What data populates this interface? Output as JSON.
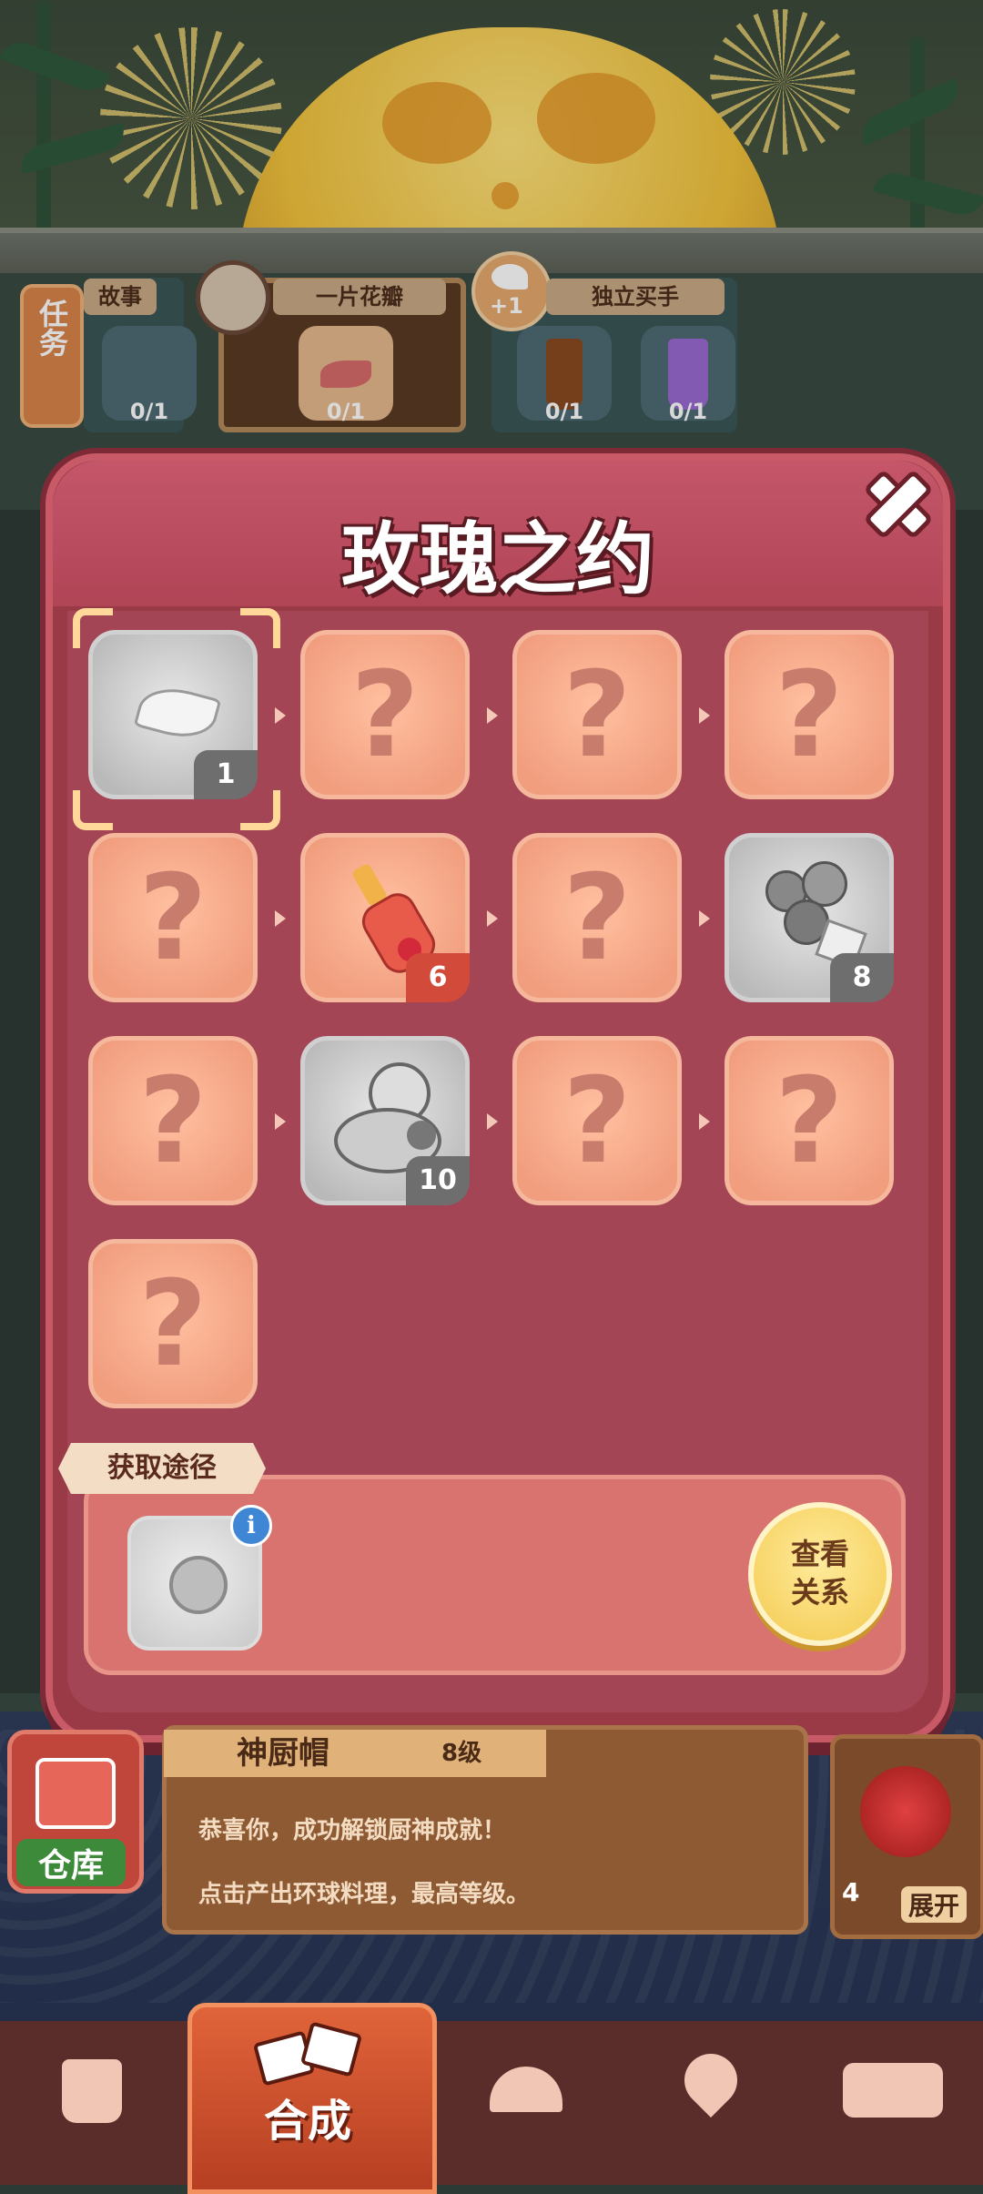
{
  "task_bar": {
    "tab_label": "任务",
    "cards": [
      {
        "header": "故事",
        "count": "0/1",
        "item": "green-jar-icon"
      },
      {
        "header": "一片花瓣",
        "count": "0/1",
        "item": "petal-icon"
      },
      {
        "header": "独立买手",
        "count": "0/1",
        "item": "coffee-cup-icon"
      },
      {
        "header": "",
        "count": "0/1",
        "item": "purple-drink-icon"
      }
    ],
    "reward_badge": "+1"
  },
  "modal": {
    "title": "玫瑰之约",
    "close_icon": "close-icon",
    "tiles": [
      {
        "kind": "silver",
        "icon": "petal-icon",
        "level": "1",
        "selected": true
      },
      {
        "kind": "unknown",
        "label": "?"
      },
      {
        "kind": "unknown",
        "label": "?"
      },
      {
        "kind": "unknown",
        "label": "?"
      },
      {
        "kind": "unknown",
        "label": "?"
      },
      {
        "kind": "item",
        "icon": "perfume-bottle-icon",
        "level": "6"
      },
      {
        "kind": "unknown",
        "label": "?"
      },
      {
        "kind": "silver",
        "icon": "rose-bouquet-icon",
        "level": "8"
      },
      {
        "kind": "unknown",
        "label": "?"
      },
      {
        "kind": "silver",
        "icon": "compact-mirror-icon",
        "level": "10"
      },
      {
        "kind": "unknown",
        "label": "?"
      },
      {
        "kind": "unknown",
        "label": "?"
      },
      {
        "kind": "unknown",
        "label": "?"
      }
    ],
    "source": {
      "label": "获取途径",
      "item_icon": "vase-icon",
      "info_icon": "info-icon",
      "info_glyph": "i",
      "button_line1": "查看",
      "button_line2": "关系"
    }
  },
  "lower_panel": {
    "warehouse_label": "仓库",
    "achievement_title": "神厨帽",
    "achievement_level": "8级",
    "line1": "恭喜你，成功解锁厨神成就！",
    "line2": "点击产出环球料理，最高等级。",
    "expand_count": "4",
    "expand_label": "展开"
  },
  "nav": {
    "items": [
      {
        "name": "shop",
        "icon": "shopping-bag-icon"
      },
      {
        "name": "merge",
        "label": "合成",
        "icon": "merge-icon",
        "active": true
      },
      {
        "name": "kitchen",
        "icon": "cloche-icon"
      },
      {
        "name": "map",
        "icon": "map-pin-icon"
      },
      {
        "name": "bus",
        "icon": "bus-icon"
      }
    ]
  },
  "colors": {
    "modal_bg": "#9a3a47",
    "tile_peach": "#f19e7f",
    "tile_silver": "#b9b9b9",
    "level_gray": "#6e6e6e",
    "level_red": "#d24a3a",
    "relation_button": "#f3c94e"
  }
}
